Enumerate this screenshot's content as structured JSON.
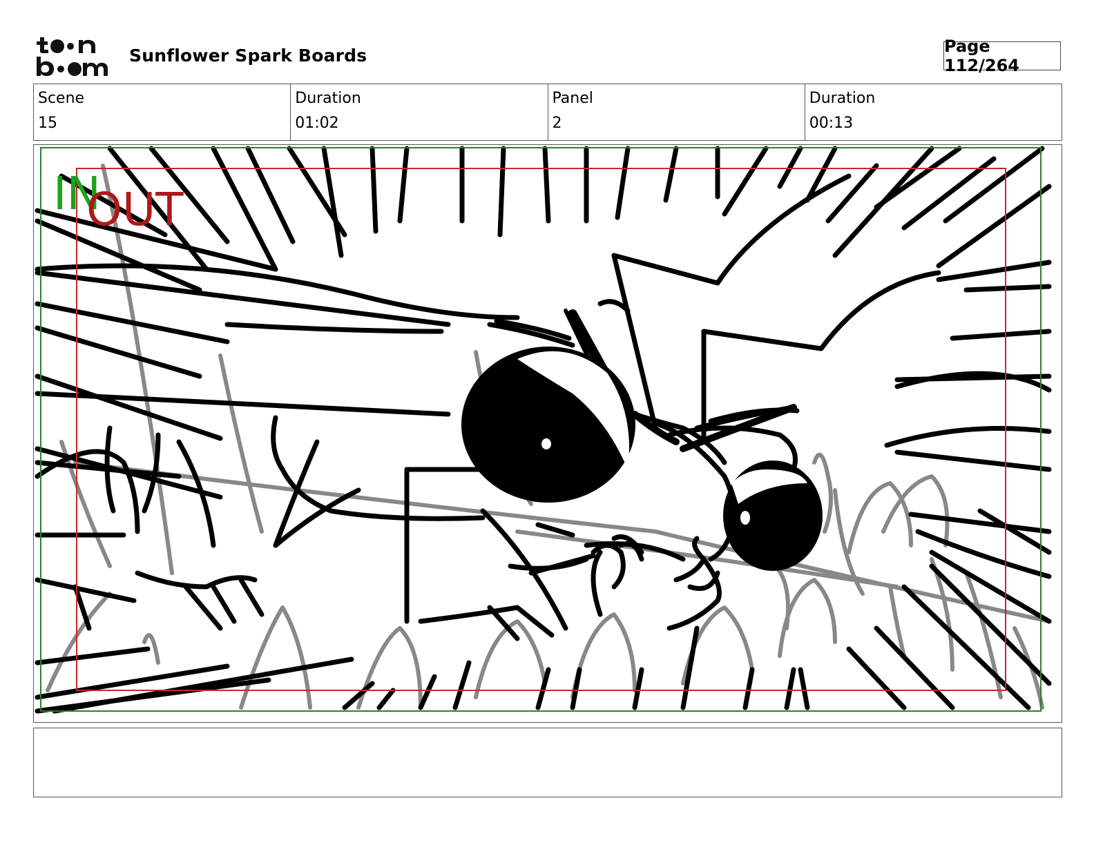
{
  "header": {
    "logo_text": "toon boom",
    "title": "Sunflower Spark Boards",
    "page_label": "Page 112/264"
  },
  "info": [
    {
      "label": "Scene",
      "value": "15"
    },
    {
      "label": "Duration",
      "value": "01:02"
    },
    {
      "label": "Panel",
      "value": "2"
    },
    {
      "label": "Duration",
      "value": "00:13"
    }
  ],
  "panel": {
    "in_label": "IN",
    "out_label": "OUT",
    "colors": {
      "in": "#1fa01f",
      "out": "#b01818",
      "safe_green": "#2e7d32",
      "safe_red": "#c62828",
      "ink": "#000000",
      "pencil": "#888888"
    }
  },
  "notes": {
    "text": ""
  }
}
